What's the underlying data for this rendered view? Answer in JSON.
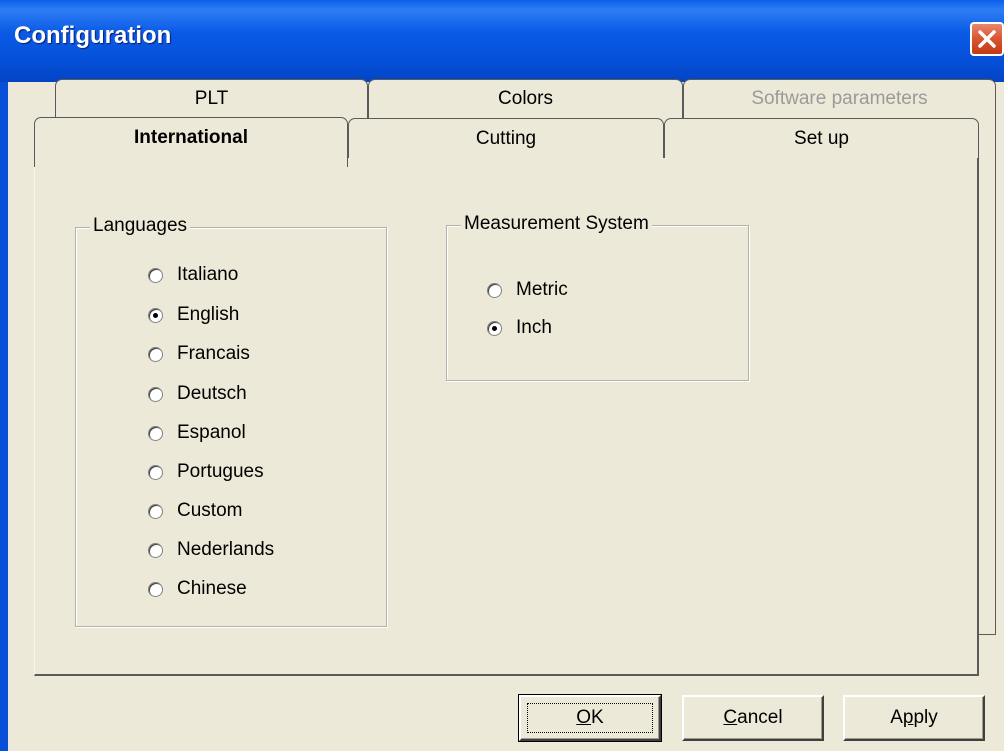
{
  "window": {
    "title": "Configuration"
  },
  "tabs_back": [
    {
      "label": "PLT"
    },
    {
      "label": "Colors"
    },
    {
      "label": "Software parameters",
      "disabled": true
    }
  ],
  "tabs_front": [
    {
      "label": "International",
      "selected": true
    },
    {
      "label": "Cutting"
    },
    {
      "label": "Set up"
    }
  ],
  "languages": {
    "legend": "Languages",
    "options": [
      {
        "label": "Italiano",
        "checked": false
      },
      {
        "label": "English",
        "checked": true
      },
      {
        "label": "Francais",
        "checked": false
      },
      {
        "label": "Deutsch",
        "checked": false
      },
      {
        "label": "Espanol",
        "checked": false
      },
      {
        "label": "Portugues",
        "checked": false
      },
      {
        "label": "Custom",
        "checked": false
      },
      {
        "label": "Nederlands",
        "checked": false
      },
      {
        "label": "Chinese",
        "checked": false
      }
    ]
  },
  "measurement": {
    "legend": "Measurement System",
    "options": [
      {
        "label": "Metric",
        "checked": false
      },
      {
        "label": "Inch",
        "checked": true
      }
    ]
  },
  "buttons": {
    "ok_mnemonic": "O",
    "ok_rest": "K",
    "cancel_mnemonic": "C",
    "cancel_rest": "ancel",
    "apply_first": "A",
    "apply_mnemonic": "p",
    "apply_rest": "ply"
  },
  "colors": {
    "titlebar": "#0a5fe8",
    "dialog_bg": "#ece9d8",
    "close_button": "#d8542e",
    "disabled_text": "#9a9a9a"
  },
  "icons": {
    "close": "close-x-icon"
  }
}
